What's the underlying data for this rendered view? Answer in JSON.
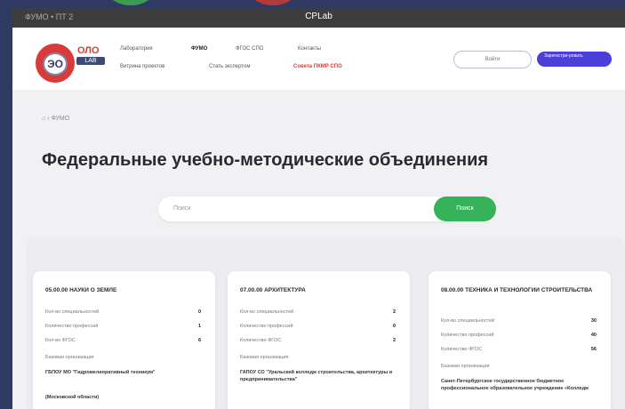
{
  "browser": {
    "title": "CPLab",
    "left_text": "ФУМО • ПТ 2"
  },
  "header": {
    "logo": {
      "text": "ОЛО",
      "badge": "LAB",
      "mark": "ЭО"
    },
    "nav_row1": [
      "Лаборатория",
      "ФУМО",
      "ФГОС СПО",
      "Контакты"
    ],
    "nav_row2": [
      "Витрина проектов",
      "Стать экспертом",
      "Совета ПКМР СПО"
    ],
    "login": "Войти",
    "register": "Зарегистри-ровать"
  },
  "breadcrumb": "ФУМО",
  "page_title": "Федеральные учебно-методические объединения",
  "search": {
    "placeholder": "Поиск",
    "button": "Поиск"
  },
  "cards": [
    {
      "title": "05.00.00 НАУКИ О ЗЕМЛЕ",
      "rows": [
        {
          "label": "Кол-во специальностей",
          "value": "0"
        },
        {
          "label": "Количество профессий",
          "value": "1"
        },
        {
          "label": "Кол-во ФГОС",
          "value": "6"
        }
      ],
      "org_label": "Базовая организация",
      "org": "ГБПОУ МО \"Гидромелиоративный техникум\"",
      "extra": "(Московской области)"
    },
    {
      "title": "07.00.00 АРХИТЕКТУРА",
      "rows": [
        {
          "label": "Кол-во специальностей",
          "value": "2"
        },
        {
          "label": "Количество профессий",
          "value": "0"
        },
        {
          "label": "Количество ФГОС",
          "value": "2"
        }
      ],
      "org_label": "Базовая организация",
      "org": "ГАПОУ СО \"Уральский колледж строительства, архитектуры и предпринимательства\"",
      "extra": ""
    },
    {
      "title": "08.00.00 ТЕХНИКА И ТЕХНОЛОГИИ СТРОИТЕЛЬСТВА",
      "rows": [
        {
          "label": "Кол-во специальностей",
          "value": "30"
        },
        {
          "label": "Количество профессий",
          "value": "40"
        },
        {
          "label": "Количество ФГОС",
          "value": "56"
        }
      ],
      "org_label": "Базовая организация",
      "org": "Санкт-Петербургское государственное бюджетное профессиональное образовательное учреждение «Колледж",
      "extra": ""
    }
  ]
}
